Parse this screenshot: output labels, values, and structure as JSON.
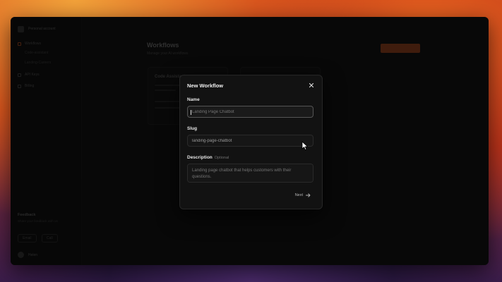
{
  "window": {
    "title": ""
  },
  "sidebar": {
    "account": "Personal account",
    "items": [
      {
        "label": "Workflows",
        "icon": "workflow-icon",
        "active": true
      },
      {
        "label": "Code-assistant"
      },
      {
        "label": "Landing-Careers"
      },
      {
        "label": "API Keys",
        "icon": "key-icon"
      },
      {
        "label": "Billing",
        "icon": "card-icon"
      }
    ],
    "feedback": {
      "title": "Feedback",
      "subtitle": "Share your feedback with us",
      "email_label": "Email",
      "call_label": "Call"
    },
    "user": "Helen"
  },
  "main": {
    "title": "Workflows",
    "subtitle": "Manage your AI workflows",
    "create_button": "Create workflow",
    "cards": [
      {
        "title": "Code Assistant"
      },
      {
        "title": ""
      }
    ]
  },
  "modal": {
    "title": "New Workflow",
    "name_label": "Name",
    "name_placeholder": "Landing Page Chatbot",
    "slug_label": "Slug",
    "slug_value": "landing-page-chatbot",
    "description_label": "Description",
    "description_optional": "Optional",
    "description_placeholder": "Landing page chatbot that helps customers with their questions.",
    "next_label": "Next",
    "icons": {
      "close": "close-icon",
      "next": "arrow-right-icon"
    }
  },
  "colors": {
    "accent": "#d2561f",
    "modal_bg": "#121212",
    "text": "#f0f0f0"
  }
}
